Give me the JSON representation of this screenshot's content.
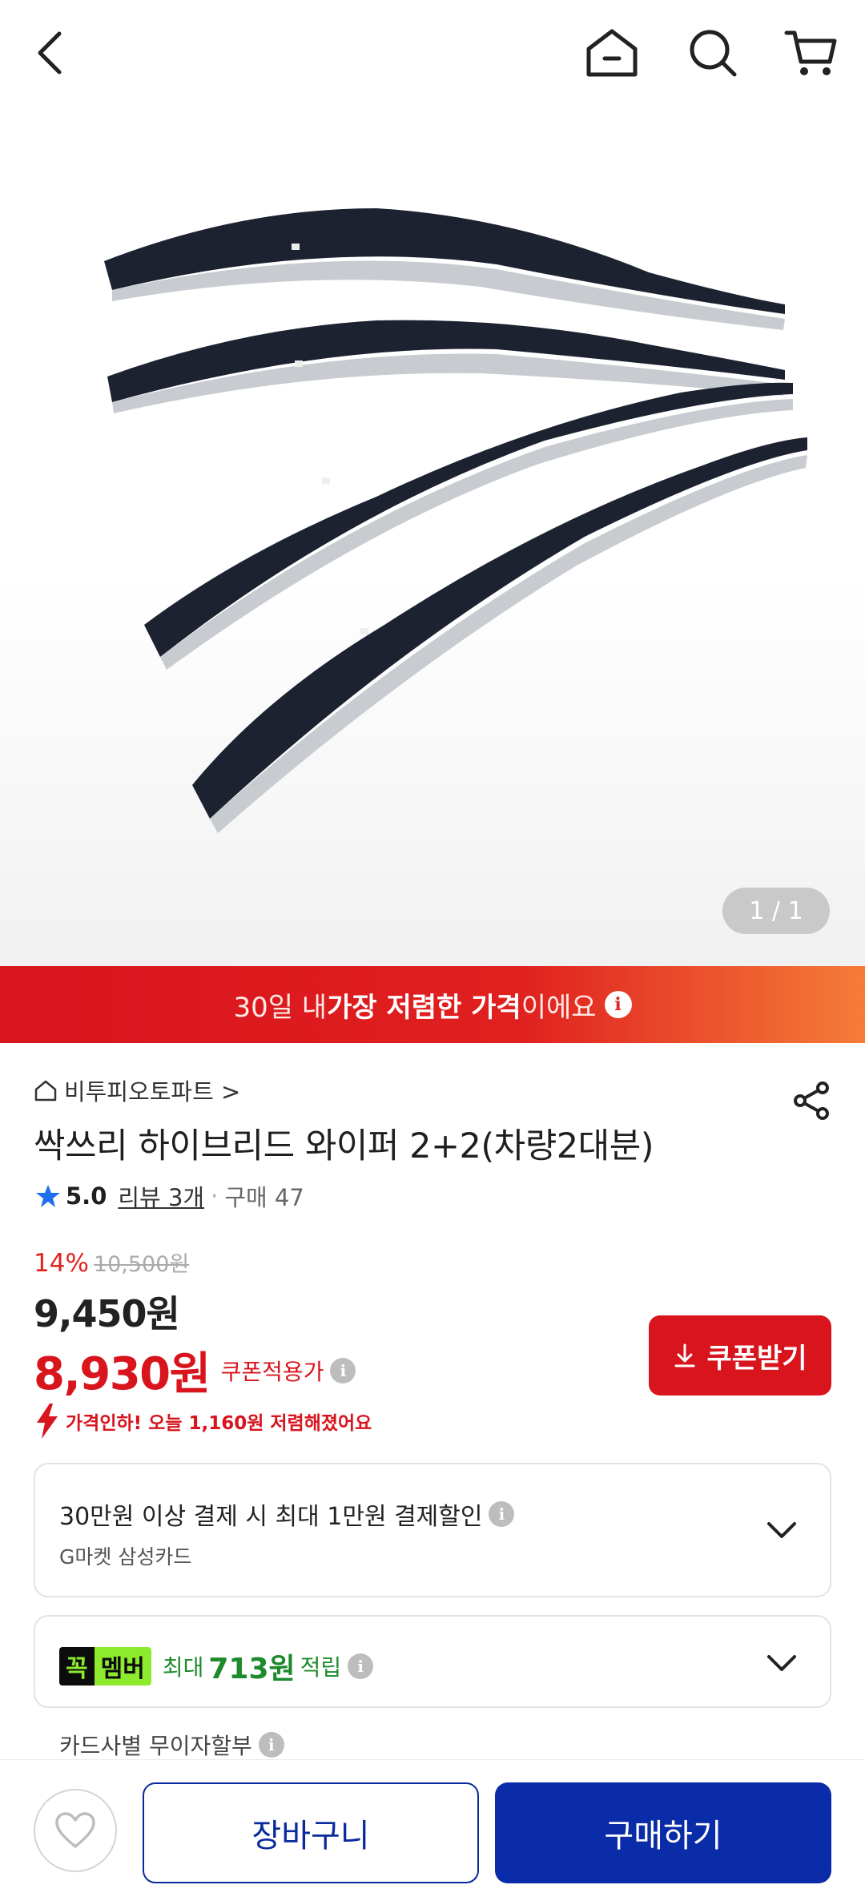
{
  "nav": {
    "back_icon": "chevron-left-icon",
    "home_icon": "home-icon",
    "search_icon": "search-icon",
    "cart_icon": "cart-icon"
  },
  "gallery": {
    "counter": "1 / 1"
  },
  "banner": {
    "prefix": "30일 내 ",
    "highlight": "가장 저렴한 가격",
    "suffix": "이에요",
    "info_icon": "i"
  },
  "product": {
    "store_name": "비투피오토파트 >",
    "title": "싹쓰리 하이브리드 와이퍼 2+2(차량2대분)",
    "rating": "5.0",
    "review_link": "리뷰 3개",
    "separator": "·",
    "purchases": "구매 47",
    "discount_rate": "14%",
    "original_price": "10,500원",
    "sale_price": "9,450원",
    "coupon_price": "8,930원",
    "coupon_label": "쿠폰적용가",
    "coupon_button": "쿠폰받기",
    "price_drop_notice": "가격인하! 오늘 1,160원 저렴해졌어요"
  },
  "payment_benefit": {
    "title": "30만원 이상 결제 시 최대 1만원 결제할인",
    "card_name": "G마켓 삼성카드"
  },
  "membership": {
    "badge_left": "꼭",
    "badge_right": "멤버",
    "prefix": "최대",
    "amount": "713원",
    "suffix": "적립"
  },
  "installment": {
    "label": "카드사별 무이자할부"
  },
  "bottom_bar": {
    "cart_label": "장바구니",
    "buy_label": "구매하기"
  },
  "colors": {
    "accent_red": "#d8141d",
    "primary_blue": "#0a2ca8",
    "member_green": "#8dea2c"
  }
}
